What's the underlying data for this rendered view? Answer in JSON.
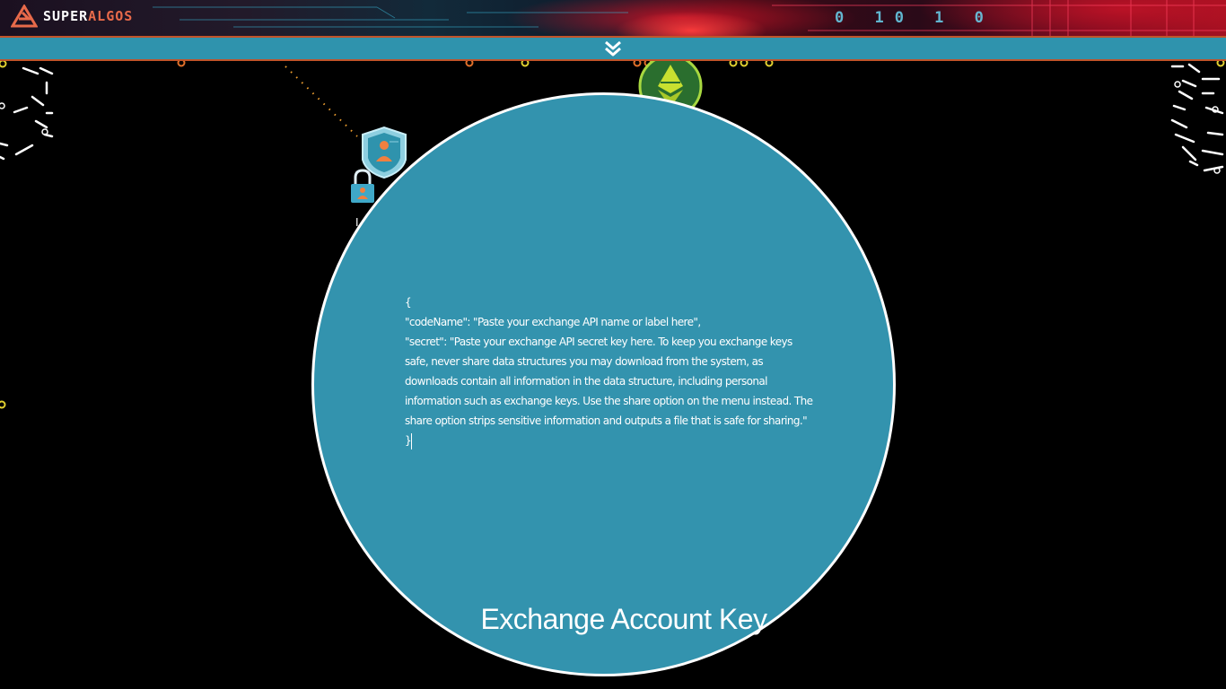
{
  "header": {
    "logo_prefix": "SUPER",
    "logo_suffix": "ALGOS",
    "binary_digits": "0 10 1 0",
    "colors": {
      "logo_accent": "#e86a4a",
      "banner_red": "#d0102a"
    }
  },
  "collapse_bar": {
    "icon": "chevron-double-down-icon",
    "color": "#2f93ad"
  },
  "canvas": {
    "nodes": [
      {
        "icon": "user-profile-shield-icon"
      },
      {
        "icon": "padlock-icon"
      },
      {
        "icon": "ethereum-classic-icon"
      }
    ]
  },
  "editor": {
    "title": "Exchange Account Key",
    "content": "{\n\"codeName\": \"Paste your exchange API name or label here\",\n\"secret\": \"Paste your exchange API secret key here. To keep you exchange keys safe, never share data structures you may download from the system, as downloads contain all information in the data structure, including personal information such as exchange keys. Use the share option on the menu instead. The share option strips sensitive information and outputs a file that is safe for sharing.\"\n}",
    "background_color": "#3393ae",
    "border_color": "#ffffff"
  }
}
